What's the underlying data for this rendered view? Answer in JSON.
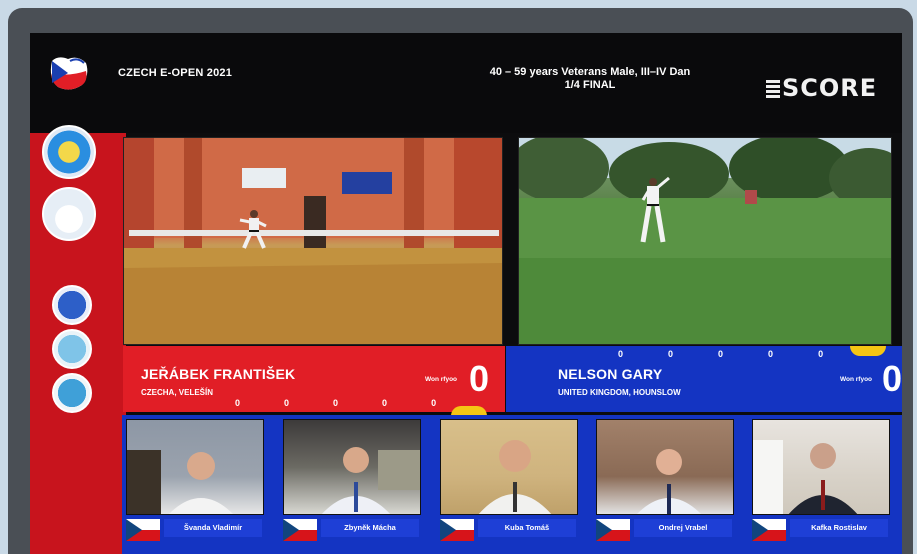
{
  "event": {
    "title": "CZECH E-OPEN 2021",
    "category_line1": "40 – 59 years Veterans Male, III–IV Dan",
    "category_line2": "1/4 FINAL",
    "brand": "SCORE"
  },
  "red": {
    "name": "JEŘÁBEK FRANTIŠEK",
    "country": "CZECHA, VELEŠÍN",
    "won_label": "Won rfyoo",
    "score": "0",
    "judge_scores": [
      "0",
      "0",
      "0",
      "0",
      "0"
    ]
  },
  "blue": {
    "name": "NELSON GARY",
    "country": "UNITED KINGDOM, HOUNSLOW",
    "won_label": "Won rfyoo",
    "score": "0",
    "judge_scores": [
      "0",
      "0",
      "0",
      "0",
      "0"
    ]
  },
  "judges": [
    {
      "name": "Švanda Vladimír",
      "flag": "czech-flag"
    },
    {
      "name": "Zbyněk Mácha",
      "flag": "czech-flag"
    },
    {
      "name": "Kuba Tomáš",
      "flag": "czech-flag"
    },
    {
      "name": "Ondrej Vrabel",
      "flag": "czech-flag"
    },
    {
      "name": "Kafka Rostislav",
      "flag": "czech-flag"
    }
  ],
  "colors": {
    "red": "#e11e26",
    "blue": "#1434c2",
    "sidebar_red": "#c8141d",
    "accent_yellow": "#f5c514"
  },
  "icons": [
    "federation-flag-icon",
    "wkf-logo-icon",
    "eko-logo-icon",
    "continental-logo-icon"
  ]
}
